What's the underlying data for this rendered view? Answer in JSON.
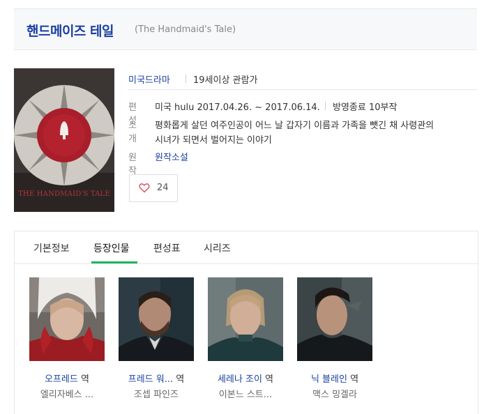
{
  "title": {
    "main": "핸드메이즈 테일",
    "sub": "(The Handmaid's Tale)"
  },
  "poster": {
    "caption": "THE HANDMAID'S TALE"
  },
  "info": {
    "genre": "미국드라마",
    "rating": "19세이상 관람가",
    "broadcast_label": "편성",
    "broadcast_value": "미국 hulu 2017.04.26. ~ 2017.06.14.",
    "status_value": "방영종료 10부작",
    "synopsis_label": "소개",
    "synopsis_line1": "평화롭게 살던 여주인공이 어느 날 갑자기 이름과 가족을 뺏긴 채 사령관의",
    "synopsis_line2": "시녀가 되면서 벌어지는 이야기",
    "original_label": "원작",
    "original_value": "원작소설",
    "like_count": "24"
  },
  "tabs": [
    {
      "label": "기본정보"
    },
    {
      "label": "등장인물"
    },
    {
      "label": "편성표"
    },
    {
      "label": "시리즈"
    }
  ],
  "cast": [
    {
      "name": "오프레드",
      "role": "역",
      "actor": "엘리자베스 ..."
    },
    {
      "name": "프레드 워...",
      "role": "역",
      "actor": "조셉 파인즈"
    },
    {
      "name": "세레나 조이",
      "role": "역",
      "actor": "이본느 스트..."
    },
    {
      "name": "닉 블레인",
      "role": "역",
      "actor": "맥스 밍겔라"
    }
  ],
  "colors": {
    "link": "#1a3fa0",
    "tab_active_underline": "#1fb65a",
    "heart": "#e0485f"
  }
}
